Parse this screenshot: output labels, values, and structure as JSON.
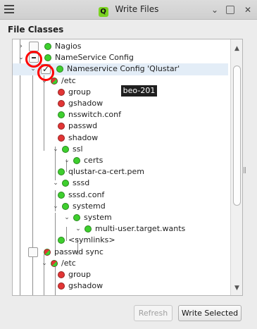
{
  "window": {
    "title": "Write Files",
    "app_icon_letter": "Q",
    "close_glyph": "✕",
    "minimize_glyph": "⌄"
  },
  "header": {
    "title": "File Classes"
  },
  "tooltip": {
    "text": "beo-201"
  },
  "tree": {
    "rows": [
      {
        "label": "Nagios",
        "status": "green",
        "expander": "›",
        "checkbox": "empty",
        "selected": false
      },
      {
        "label": "NameService Config",
        "status": "green",
        "expander": "⌄",
        "checkbox": "partial",
        "selected": false
      },
      {
        "label": "Nameservice Config 'Qlustar'",
        "status": "green",
        "expander": "⌄",
        "checkbox": "checked",
        "selected": true
      },
      {
        "label": "/etc",
        "status": "mixed",
        "expander": "⌄",
        "checkbox": "none",
        "selected": false
      },
      {
        "label": "group",
        "status": "red",
        "expander": "",
        "checkbox": "none",
        "selected": false
      },
      {
        "label": "gshadow",
        "status": "red",
        "expander": "",
        "checkbox": "none",
        "selected": false
      },
      {
        "label": "nsswitch.conf",
        "status": "green",
        "expander": "",
        "checkbox": "none",
        "selected": false
      },
      {
        "label": "passwd",
        "status": "red",
        "expander": "",
        "checkbox": "none",
        "selected": false
      },
      {
        "label": "shadow",
        "status": "red",
        "expander": "",
        "checkbox": "none",
        "selected": false
      },
      {
        "label": "ssl",
        "status": "green",
        "expander": "⌄",
        "checkbox": "none",
        "selected": false
      },
      {
        "label": "certs",
        "status": "green",
        "expander": "⌄",
        "checkbox": "none",
        "selected": false
      },
      {
        "label": "qlustar-ca-cert.pem",
        "status": "green",
        "expander": "",
        "checkbox": "none",
        "selected": false
      },
      {
        "label": "sssd",
        "status": "green",
        "expander": "⌄",
        "checkbox": "none",
        "selected": false
      },
      {
        "label": "sssd.conf",
        "status": "green",
        "expander": "",
        "checkbox": "none",
        "selected": false
      },
      {
        "label": "systemd",
        "status": "green",
        "expander": "⌄",
        "checkbox": "none",
        "selected": false
      },
      {
        "label": "system",
        "status": "green",
        "expander": "⌄",
        "checkbox": "none",
        "selected": false
      },
      {
        "label": "multi-user.target.wants",
        "status": "green",
        "expander": "⌄",
        "checkbox": "none",
        "selected": false
      },
      {
        "label": "<symlinks>",
        "status": "green",
        "expander": "",
        "checkbox": "none",
        "selected": false
      },
      {
        "label": "passwd sync",
        "status": "mixed",
        "expander": "⌄",
        "checkbox": "empty",
        "selected": false
      },
      {
        "label": "/etc",
        "status": "mixed",
        "expander": "⌄",
        "checkbox": "none",
        "selected": false
      },
      {
        "label": "group",
        "status": "red",
        "expander": "",
        "checkbox": "none",
        "selected": false
      },
      {
        "label": "gshadow",
        "status": "red",
        "expander": "",
        "checkbox": "none",
        "selected": false
      }
    ]
  },
  "scrollbar": {
    "up_arrow": "▲",
    "down_arrow": "▼"
  },
  "buttons": {
    "refresh": "Refresh",
    "write_selected": "Write Selected"
  }
}
